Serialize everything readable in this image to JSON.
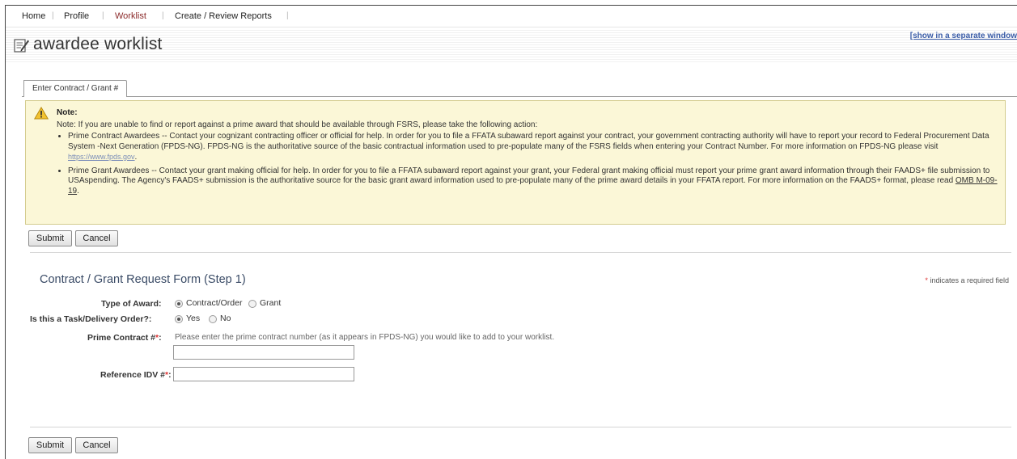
{
  "nav": {
    "items": [
      {
        "label": "Home"
      },
      {
        "label": "Profile"
      },
      {
        "label": "Worklist"
      },
      {
        "label": "Create / Review Reports"
      }
    ],
    "active": "Worklist",
    "separator": "|"
  },
  "header": {
    "title": "awardee worklist",
    "separate_window_link": "[show in a separate window"
  },
  "tabs": [
    {
      "label": "Enter Contract / Grant #"
    }
  ],
  "note": {
    "title": "Note:",
    "intro": "Note: If you are unable to find or report against a prime award that should be available through FSRS, please take the following action:",
    "bullet1_text": "Prime Contract Awardees -- Contact your cognizant contracting officer or official for help. In order for you to file a FFATA subaward report against your contract, your government contracting authority will have to report your record to Federal Procurement Data System -Next Generation (FPDS-NG). FPDS-NG is the authoritative source of the basic contractual information used to pre-populate many of the FSRS fields when entering your Contract Number. For more information on FPDS-NG please visit ",
    "bullet1_link": "https://www.fpds.gov",
    "bullet1_end": ".",
    "bullet2_text": "Prime Grant Awardees -- Contact your grant making official for help. In order for you to file a FFATA subaward report against your grant, your Federal grant making official must report your prime grant award information through their FAADS+ file submission to USAspending. The Agency's FAADS+ submission is the authoritative source for the basic grant award information used to pre-populate many of the prime award details in your FFATA report. For more information on the FAADS+ format, please read ",
    "bullet2_link": "OMB M-09-19",
    "bullet2_end": "."
  },
  "buttons": {
    "submit": "Submit",
    "cancel": "Cancel"
  },
  "form": {
    "title": "Contract / Grant Request Form (Step 1)",
    "required_star": "*",
    "required_note": " indicates a required field",
    "type_of_award_label": "Type of Award:",
    "type_of_award_options": [
      "Contract/Order",
      "Grant"
    ],
    "type_of_award_selected": "Contract/Order",
    "task_order_label": "Is this a Task/Delivery Order?:",
    "task_order_options": [
      "Yes",
      "No"
    ],
    "task_order_selected": "Yes",
    "prime_contract_label": "Prime Contract #",
    "prime_contract_hint": "Please enter the prime contract number (as it appears in FPDS-NG) you would like to add to your worklist.",
    "prime_contract_value": "",
    "reference_idv_label": "Reference IDV #",
    "reference_idv_value": "",
    "label_suffix": ":"
  },
  "colors": {
    "note_bg": "#fbf7d7",
    "active_nav": "#8b2a2a",
    "form_title": "#3a4b66",
    "required": "#dd3333"
  }
}
